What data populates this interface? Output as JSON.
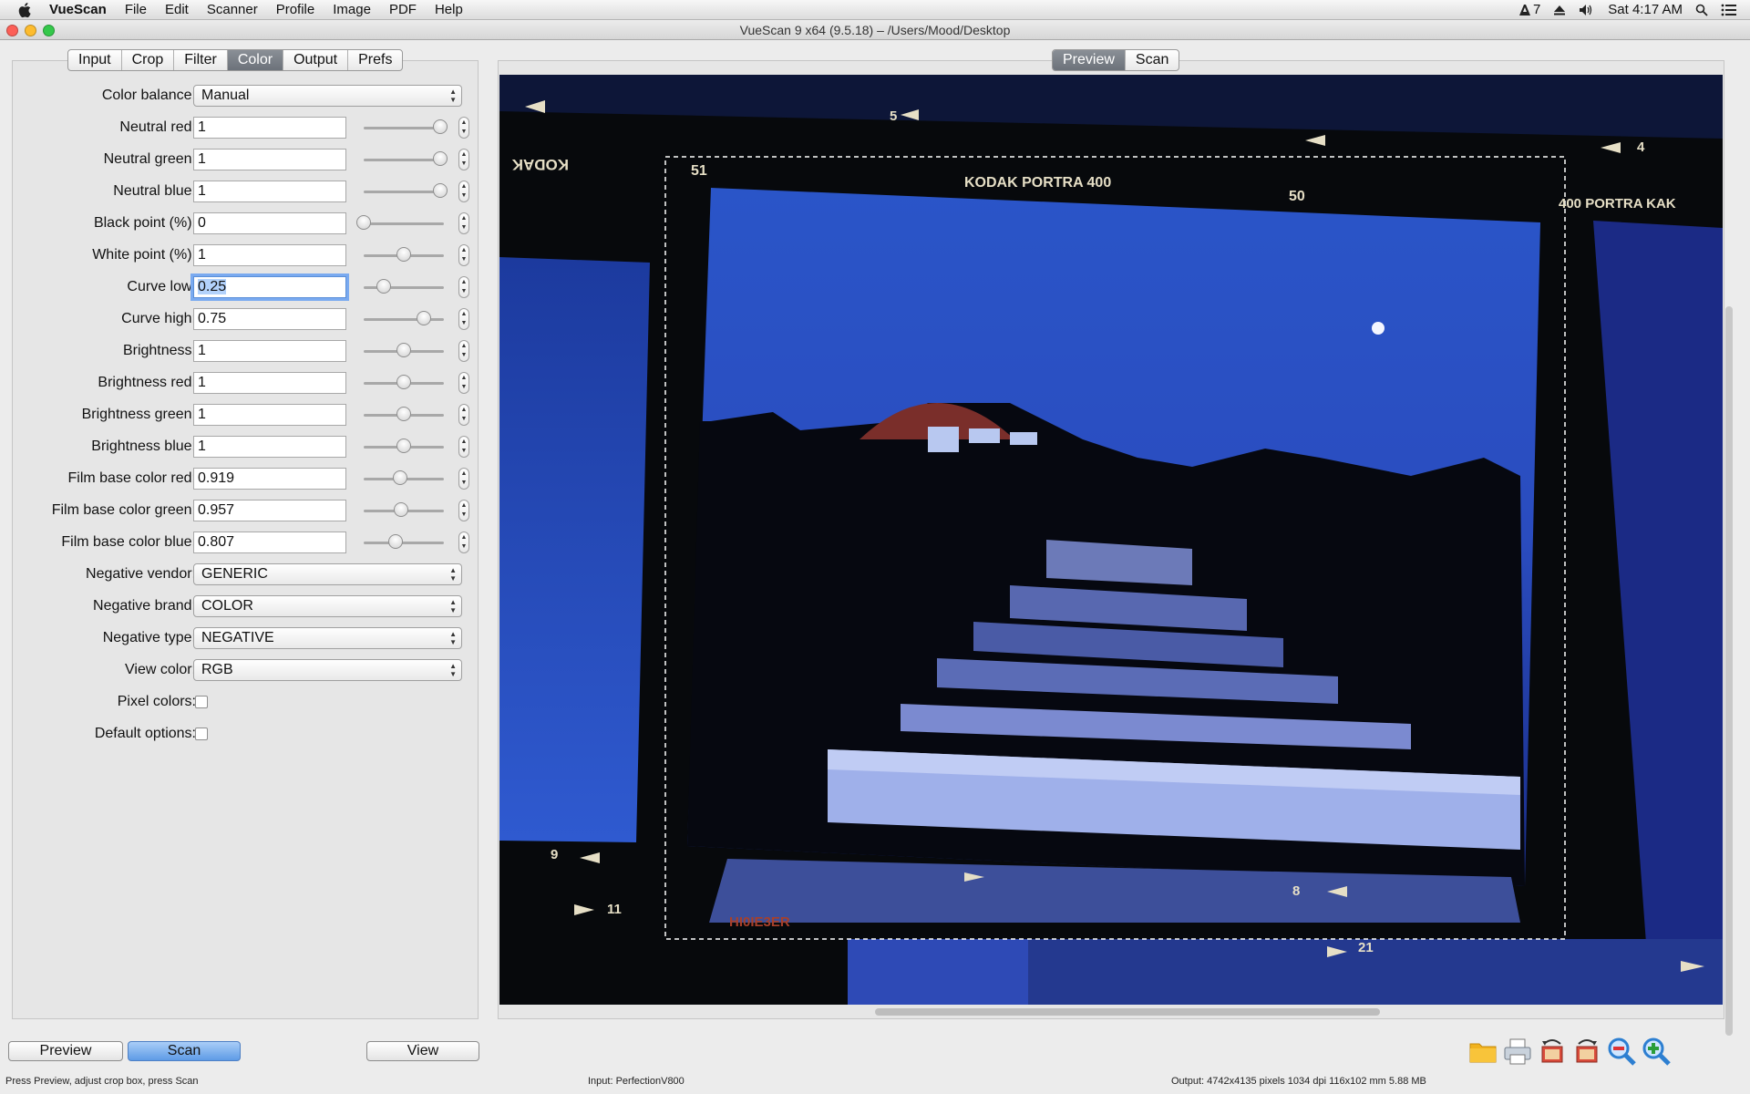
{
  "menubar": {
    "app": "VueScan",
    "items": [
      "File",
      "Edit",
      "Scanner",
      "Profile",
      "Image",
      "PDF",
      "Help"
    ],
    "adobe_count": "7",
    "clock": "Sat 4:17 AM"
  },
  "window": {
    "title": "VueScan 9 x64 (9.5.18) – /Users/Mood/Desktop"
  },
  "tabs": [
    "Input",
    "Crop",
    "Filter",
    "Color",
    "Output",
    "Prefs"
  ],
  "active_tab": "Color",
  "color": {
    "color_balance": {
      "label": "Color balance:",
      "value": "Manual"
    },
    "fields": [
      {
        "label": "Neutral red:",
        "value": "1",
        "slider": 0.95
      },
      {
        "label": "Neutral green:",
        "value": "1",
        "slider": 0.95
      },
      {
        "label": "Neutral blue:",
        "value": "1",
        "slider": 0.95
      },
      {
        "label": "Black point (%):",
        "value": "0",
        "slider": 0.0
      },
      {
        "label": "White point (%):",
        "value": "1",
        "slider": 0.5
      },
      {
        "label": "Curve low:",
        "value": "0.25",
        "slider": 0.25
      },
      {
        "label": "Curve high:",
        "value": "0.75",
        "slider": 0.75
      },
      {
        "label": "Brightness:",
        "value": "1",
        "slider": 0.5
      },
      {
        "label": "Brightness red:",
        "value": "1",
        "slider": 0.5
      },
      {
        "label": "Brightness green:",
        "value": "1",
        "slider": 0.5
      },
      {
        "label": "Brightness blue:",
        "value": "1",
        "slider": 0.5
      },
      {
        "label": "Film base color red:",
        "value": "0.919",
        "slider": 0.45
      },
      {
        "label": "Film base color green:",
        "value": "0.957",
        "slider": 0.47
      },
      {
        "label": "Film base color blue:",
        "value": "0.807",
        "slider": 0.4
      }
    ],
    "selects": [
      {
        "label": "Negative vendor:",
        "value": "GENERIC"
      },
      {
        "label": "Negative brand:",
        "value": "COLOR"
      },
      {
        "label": "Negative type:",
        "value": "NEGATIVE"
      },
      {
        "label": "View color:",
        "value": "RGB"
      }
    ],
    "checks": [
      {
        "label": "Pixel colors:",
        "checked": false
      },
      {
        "label": "Default options:",
        "checked": false
      }
    ]
  },
  "preview_tabs": [
    "Preview",
    "Scan"
  ],
  "active_preview_tab": "Preview",
  "film_text": {
    "kodak_left": "KODAK",
    "frame_51": "51",
    "portra": "KODAK PORTRA 400",
    "frame_50": "50",
    "portra_right": "400 PORTRA  KAK",
    "frame_4": "4",
    "frame_5": "5",
    "frame_9": "9",
    "frame_8": "8",
    "frame_11": "11",
    "frame_21": "21",
    "lot_code": "HI0IE3ER"
  },
  "buttons": {
    "preview": "Preview",
    "scan": "Scan",
    "view": "View"
  },
  "toolbar_icons": [
    "folder-icon",
    "print-icon",
    "rotate-left-icon",
    "rotate-right-icon",
    "zoom-out-icon",
    "zoom-in-icon"
  ],
  "status": {
    "left": "Press Preview, adjust crop box, press Scan",
    "middle": "Input: PerfectionV800",
    "right": "Output: 4742x4135 pixels 1034 dpi 116x102 mm 5.88 MB"
  }
}
